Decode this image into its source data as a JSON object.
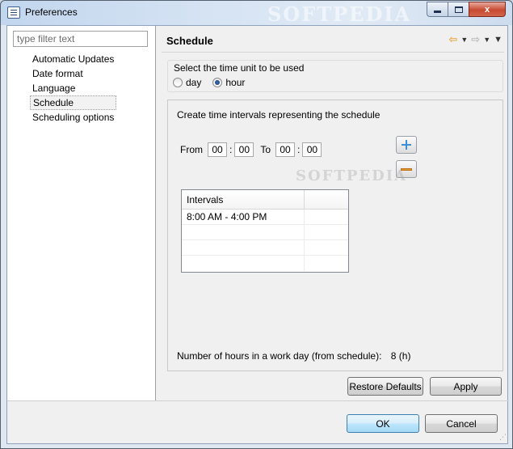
{
  "window": {
    "title": "Preferences",
    "watermark": "SOFTPEDIA",
    "controls": {
      "minimize": "",
      "maximize": "",
      "close": "x"
    }
  },
  "sidebar": {
    "filter_placeholder": "type filter text",
    "items": [
      {
        "label": "Automatic Updates"
      },
      {
        "label": "Date format"
      },
      {
        "label": "Language"
      },
      {
        "label": "Schedule",
        "selected": true
      },
      {
        "label": "Scheduling options"
      }
    ]
  },
  "page": {
    "title": "Schedule",
    "nav": {
      "back_icon": "back-arrow-icon",
      "forward_icon": "forward-arrow-icon",
      "menu_icon": "chevron-down-icon"
    },
    "unit_group": {
      "label": "Select the time unit to be used",
      "options": [
        {
          "label": "day",
          "selected": false
        },
        {
          "label": "hour",
          "selected": true
        }
      ]
    },
    "interval_group": {
      "label": "Create time intervals representing the schedule",
      "from_label": "From",
      "to_label": "To",
      "from_hours": "00",
      "from_minutes": "00",
      "to_hours": "00",
      "to_minutes": "00",
      "table": {
        "column_header": "Intervals",
        "rows": [
          "8:00 AM - 4:00 PM",
          "",
          "",
          ""
        ]
      },
      "watermark": "SOFTPEDIA",
      "hours_label": "Number of hours in a work day  (from schedule):",
      "hours_value": "8 (h)"
    },
    "restore_defaults_label": "Restore Defaults",
    "apply_label": "Apply"
  },
  "footer": {
    "ok_label": "OK",
    "cancel_label": "Cancel"
  },
  "colors": {
    "add_icon": "#3d8ed8",
    "remove_icon": "#e39a2f",
    "back_arrow": "#e8a33a"
  }
}
